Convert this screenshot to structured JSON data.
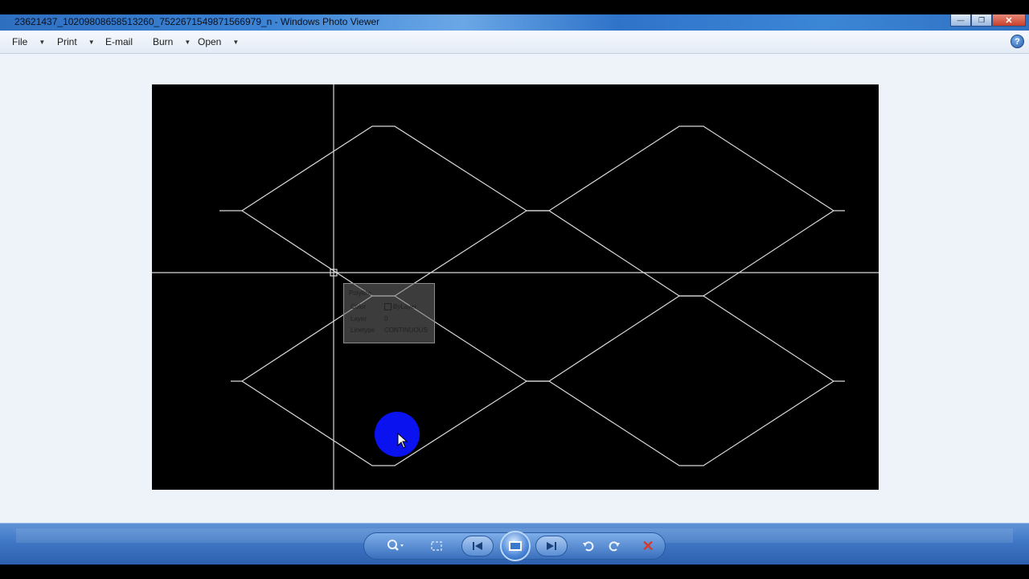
{
  "window": {
    "title": "23621437_10209808658513260_7522671549871566979_n - Windows Photo Viewer",
    "controls": {
      "minimize": "—",
      "maximize": "❐",
      "close": "✕"
    }
  },
  "menu": {
    "items": [
      {
        "label": "File",
        "has_dropdown": true
      },
      {
        "label": "Print",
        "has_dropdown": true
      },
      {
        "label": "E-mail",
        "has_dropdown": false
      },
      {
        "label": "Burn",
        "has_dropdown": true
      },
      {
        "label": "Open",
        "has_dropdown": true
      }
    ],
    "dropdown_glyph": "▼",
    "help_label": "?"
  },
  "image_content": {
    "tooltip": {
      "title": "Polyline",
      "rows": [
        {
          "key": "Color",
          "value": "ByLayer",
          "has_swatch": true
        },
        {
          "key": "Layer",
          "value": "0"
        },
        {
          "key": "Linetype",
          "value": "CONTINUOUS"
        }
      ]
    },
    "colors": {
      "background": "#000000",
      "lines": "#d8d8d8",
      "click_indicator": "#0b12f0"
    }
  },
  "toolbar": {
    "zoom_icon": "magnifier-icon",
    "actual_size_icon": "fit-icon",
    "previous_icon": "previous-icon",
    "slideshow_icon": "slideshow-icon",
    "next_icon": "next-icon",
    "rotate_ccw_icon": "rotate-ccw-icon",
    "rotate_cw_icon": "rotate-cw-icon",
    "delete_icon": "delete-icon"
  }
}
